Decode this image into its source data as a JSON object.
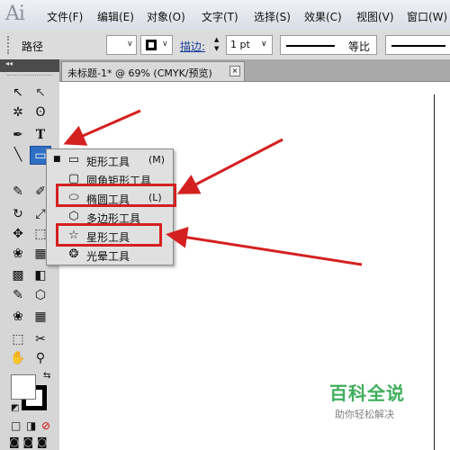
{
  "app": {
    "logo": "Ai"
  },
  "menu": [
    "文件(F)",
    "编辑(E)",
    "对象(O)",
    "文字(T)",
    "选择(S)",
    "效果(C)",
    "视图(V)",
    "窗口(W)"
  ],
  "controlbar": {
    "path_label": "路径",
    "stroke_label": "描边:",
    "stroke_value": "1 pt",
    "profile_label": "等比",
    "stepper_up": "▲",
    "stepper_down": "▼",
    "dropdown_arrow": "∨"
  },
  "panel_collapse": "◂◂",
  "document_tab": {
    "title": "未标题-1* @ 69% (CMYK/预览)",
    "close": "×"
  },
  "toolbox": {
    "glyphs": {
      "selection": "↖",
      "direct_selection": "↖",
      "magic_wand": "✲",
      "lasso": "ʘ",
      "pen": "✒",
      "type": "T",
      "line": "╲",
      "rectangle": "▭",
      "paintbrush": "✎",
      "pencil": "✐",
      "rotate": "↻",
      "scale": "⤢",
      "warp": "✥",
      "free_transform": "⬚",
      "symbol_sprayer": "❀",
      "column_graph": "▦",
      "mesh": "▩",
      "gradient": "◧",
      "eyedropper": "✎",
      "blend": "⬡",
      "slice": "✂",
      "eraser": "✐",
      "hand": "✋",
      "zoom": "⚲",
      "fill_swatch": "",
      "swap": "⇆",
      "default": "◩",
      "color_mode": "□",
      "gradient_mode": "◨",
      "none_mode": "⊘",
      "screen_modes": "◙ ◙ ◙"
    }
  },
  "flyout": {
    "items": [
      {
        "label": "矩形工具",
        "shortcut": "(M)",
        "icon": "▭",
        "active": true,
        "bullet": "■"
      },
      {
        "label": "圆角矩形工具",
        "shortcut": "",
        "icon": "▢",
        "active": false,
        "bullet": ""
      },
      {
        "label": "椭圆工具",
        "shortcut": "(L)",
        "icon": "⬭",
        "active": false,
        "bullet": ""
      },
      {
        "label": "多边形工具",
        "shortcut": "",
        "icon": "⬡",
        "active": false,
        "bullet": ""
      },
      {
        "label": "星形工具",
        "shortcut": "",
        "icon": "☆",
        "active": false,
        "bullet": ""
      },
      {
        "label": "光晕工具",
        "shortcut": "",
        "icon": "❂",
        "active": false,
        "bullet": ""
      }
    ]
  },
  "colors": {
    "annotation_red": "#d52020",
    "selected_tool": "#2f6fc4"
  },
  "watermark": {
    "title": "百科全说",
    "subtitle": "助你轻松解决"
  }
}
